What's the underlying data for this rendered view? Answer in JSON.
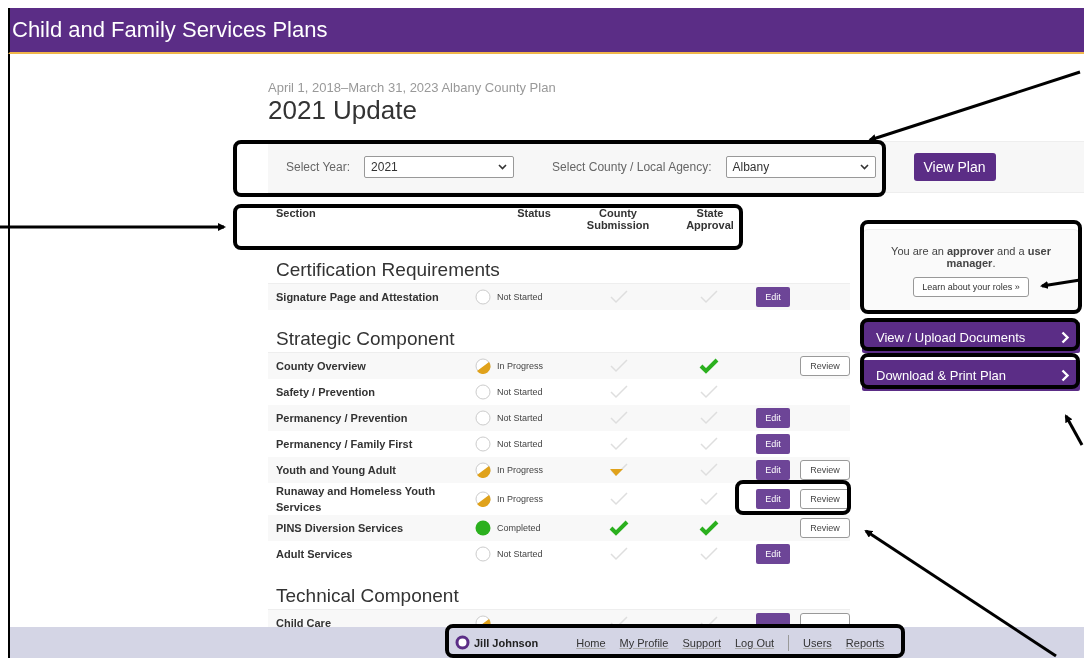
{
  "app_title": "Child and Family Services Plans",
  "plan_period": "April 1, 2018–March 31, 2023 Albany County Plan",
  "page_title": "2021 Update",
  "filters": [
    {
      "label": "Select Year:",
      "value": "2021"
    },
    {
      "label": "Select County / Local Agency:",
      "value": "Albany"
    }
  ],
  "view_button": "View Plan",
  "columns": [
    "Section",
    "Status",
    "County Submission",
    "State Approval"
  ],
  "groups": [
    {
      "title": "Certification Requirements",
      "rows": [
        {
          "section": "Signature Page and Attestation",
          "status": {
            "kind": "empty",
            "label": "Not Started"
          },
          "county": {
            "kind": "empty"
          },
          "state": {
            "kind": "empty"
          },
          "buttons": [
            {
              "kind": "edit",
              "label": "Edit"
            }
          ]
        }
      ]
    },
    {
      "title": "Strategic Component",
      "rows": [
        {
          "section": "County Overview",
          "status": {
            "kind": "half",
            "label": "In Progress"
          },
          "county": {
            "kind": "empty"
          },
          "state": {
            "kind": "full"
          },
          "buttons": [
            {
              "kind": "review",
              "label": "Review"
            }
          ]
        },
        {
          "section": "Safety / Prevention",
          "status": {
            "kind": "empty",
            "label": "Not Started"
          },
          "county": {
            "kind": "empty"
          },
          "state": {
            "kind": "empty"
          },
          "buttons": []
        },
        {
          "section": "Permanency / Prevention",
          "status": {
            "kind": "empty",
            "label": "Not Started"
          },
          "county": {
            "kind": "empty"
          },
          "state": {
            "kind": "empty"
          },
          "buttons": [
            {
              "kind": "edit",
              "label": "Edit"
            }
          ]
        },
        {
          "section": "Permanency / Family First",
          "status": {
            "kind": "empty",
            "label": "Not Started"
          },
          "county": {
            "kind": "empty"
          },
          "state": {
            "kind": "empty"
          },
          "buttons": [
            {
              "kind": "edit",
              "label": "Edit"
            }
          ]
        },
        {
          "section": "Youth and Young Adult",
          "status": {
            "kind": "half",
            "label": "In Progress"
          },
          "county": {
            "kind": "half"
          },
          "state": {
            "kind": "empty"
          },
          "buttons": [
            {
              "kind": "edit",
              "label": "Edit"
            },
            {
              "kind": "review",
              "label": "Review"
            }
          ]
        },
        {
          "section": "Runaway and Homeless Youth Services",
          "status": {
            "kind": "half",
            "label": "In Progress"
          },
          "county": {
            "kind": "empty"
          },
          "state": {
            "kind": "empty"
          },
          "buttons": [
            {
              "kind": "edit",
              "label": "Edit"
            },
            {
              "kind": "review",
              "label": "Review"
            }
          ]
        },
        {
          "section": "PINS Diversion Services",
          "status": {
            "kind": "full",
            "label": "Completed"
          },
          "county": {
            "kind": "full"
          },
          "state": {
            "kind": "full"
          },
          "buttons": [
            {
              "kind": "review",
              "label": "Review"
            }
          ]
        },
        {
          "section": "Adult Services",
          "status": {
            "kind": "empty",
            "label": "Not Started"
          },
          "county": {
            "kind": "empty"
          },
          "state": {
            "kind": "empty"
          },
          "buttons": [
            {
              "kind": "edit",
              "label": "Edit"
            }
          ]
        }
      ]
    },
    {
      "title": "Technical Component",
      "rows": [
        {
          "section": "Child Care",
          "status": {
            "kind": "half"
          },
          "county": {
            "kind": "empty"
          },
          "state": {
            "kind": "empty"
          },
          "buttons": [
            {
              "kind": "edit"
            },
            {
              "kind": "review"
            }
          ]
        }
      ]
    }
  ],
  "roles_note": "You are an **approver** and a **user manager**.",
  "roles_button": "Learn about your roles »",
  "side_links": [
    "View / Upload Documents",
    "Download & Print Plan"
  ],
  "footer": {
    "user": "Jill Johnson",
    "links": [
      "Home",
      "My Profile",
      "Support",
      "Log Out"
    ],
    "admin_links": [
      "Users",
      "Reports"
    ]
  }
}
